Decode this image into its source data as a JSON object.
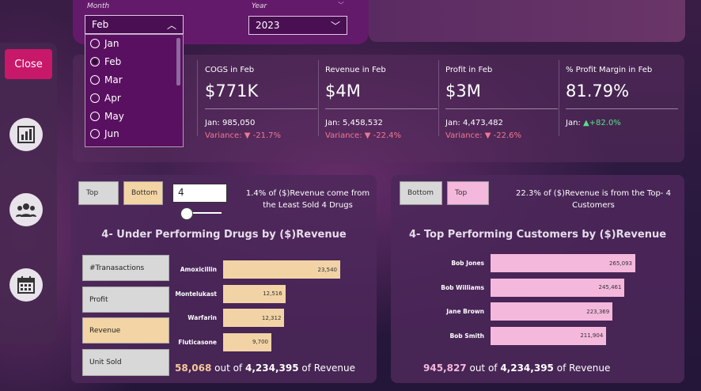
{
  "filters": {
    "month": {
      "label": "Month",
      "value": "Feb",
      "options": [
        "Jan",
        "Feb",
        "Mar",
        "Apr",
        "May",
        "Jun"
      ],
      "selected": "Feb"
    },
    "year": {
      "label": "Year",
      "value": "2023"
    }
  },
  "sidebar": {
    "close_label": "Close",
    "icons": [
      "bar-chart-icon",
      "people-icon",
      "calendar-icon"
    ]
  },
  "kpis": [
    {
      "title": "COGS in Feb",
      "value": "$771K",
      "jan": "Jan: 985,050",
      "variance_label": "Variance: ",
      "variance": "▼ -21.7%",
      "variance_color": "#f07890"
    },
    {
      "title": "Revenue in Feb",
      "value": "$4M",
      "jan": "Jan: 5,458,532",
      "variance_label": "Variance: ",
      "variance": "▼ -22.4%",
      "variance_color": "#f07890"
    },
    {
      "title": "Profit in Feb",
      "value": "$3M",
      "jan": "Jan: 4,473,482",
      "variance_label": "Variance: ",
      "variance": "▼ -22.6%",
      "variance_color": "#f07890"
    },
    {
      "title": "% Profit Margin in Feb",
      "value": "81.79%",
      "jan": "Jan: ",
      "variance": "▲+82.0%",
      "variance_color": "#58e08a"
    }
  ],
  "drugs_panel": {
    "toggle_top": "Top",
    "toggle_bottom": "Bottom",
    "n_value": "4",
    "note": "1.4% of ($)Revenue come from the Least Sold 4 Drugs",
    "title": "4- Under Performing Drugs by ($)Revenue",
    "measures": [
      "#Tranasactions",
      "Profit",
      "Revenue",
      "Unit Sold"
    ],
    "active_measure": "Revenue",
    "footer_value": "58,068",
    "footer_mid": " out of ",
    "footer_total": "4,234,395",
    "footer_tail": " of Revenue"
  },
  "customers_panel": {
    "toggle_bottom": "Bottom",
    "toggle_top": "Top",
    "note": "22.3% of ($)Revenue is from the Top- 4 Customers",
    "title": "4- Top Performing Customers by ($)Revenue",
    "footer_value": "945,827",
    "footer_mid": " out of ",
    "footer_total": "4,234,395",
    "footer_tail": " of Revenue"
  },
  "chart_data": [
    {
      "type": "bar",
      "title": "4- Under Performing Drugs by ($)Revenue",
      "categories": [
        "Amoxicillin",
        "Montelukast",
        "Warfarin",
        "Fluticasone"
      ],
      "values": [
        23540,
        12516,
        12312,
        9700
      ],
      "labels": [
        "23,540",
        "12,516",
        "12,312",
        "9,700"
      ],
      "color": "#f2d3a6"
    },
    {
      "type": "bar",
      "title": "4- Top Performing Customers by ($)Revenue",
      "categories": [
        "Bob Jones",
        "Bob Williams",
        "Jane Brown",
        "Bob Smith"
      ],
      "values": [
        265093,
        245461,
        223369,
        211904
      ],
      "labels": [
        "265,093",
        "245,461",
        "223,369",
        "211,904"
      ],
      "color": "#f4b8dc"
    }
  ]
}
